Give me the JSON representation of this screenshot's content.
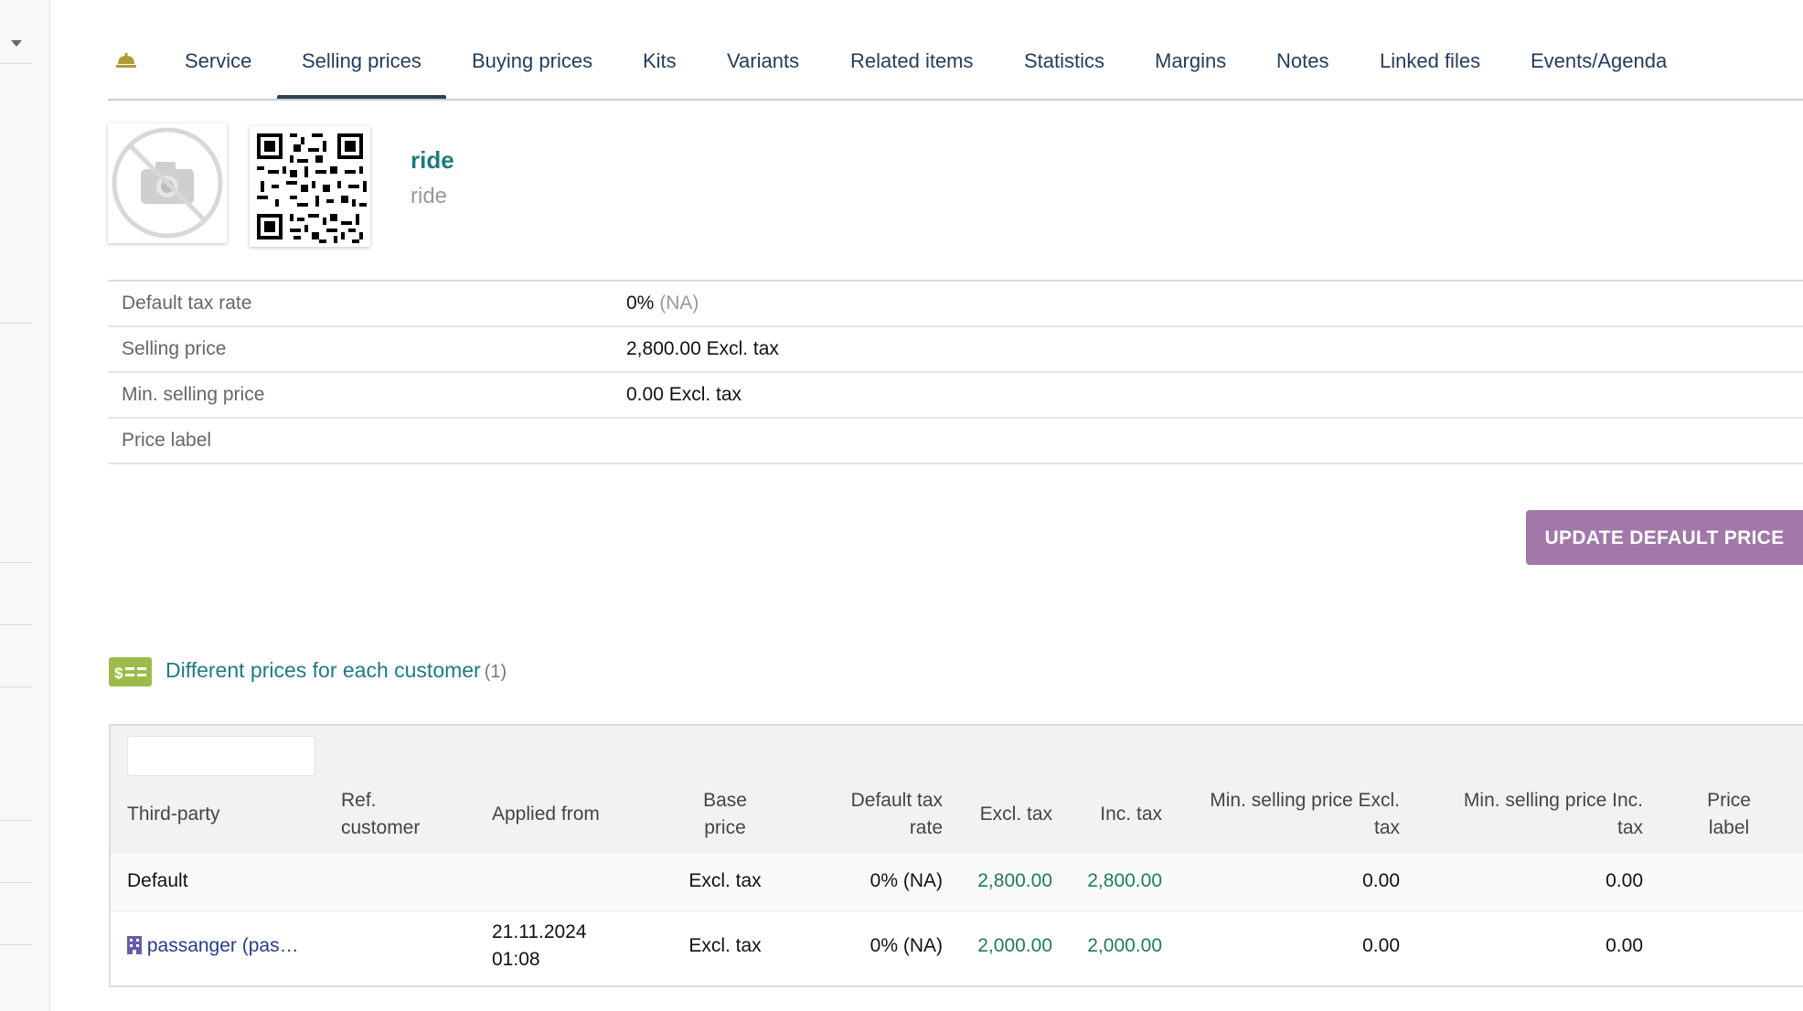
{
  "tabs": [
    {
      "label": "Service"
    },
    {
      "label": "Selling prices"
    },
    {
      "label": "Buying prices"
    },
    {
      "label": "Kits"
    },
    {
      "label": "Variants"
    },
    {
      "label": "Related items"
    },
    {
      "label": "Statistics"
    },
    {
      "label": "Margins"
    },
    {
      "label": "Notes"
    },
    {
      "label": "Linked files"
    },
    {
      "label": "Events/Agenda"
    }
  ],
  "active_tab": "Selling prices",
  "product": {
    "ref": "ride",
    "label": "ride"
  },
  "properties": [
    {
      "key": "Default tax rate",
      "value": "0%",
      "note": "(NA)"
    },
    {
      "key": "Selling price",
      "value": "2,800.00 Excl. tax",
      "note": ""
    },
    {
      "key": "Min. selling price",
      "value": "0.00 Excl. tax",
      "note": ""
    },
    {
      "key": "Price label",
      "value": "",
      "note": ""
    }
  ],
  "update_button": "UPDATE DEFAULT PRICE",
  "section": {
    "title": "Different prices for each customer",
    "count": "(1)"
  },
  "table": {
    "filter_placeholder": "",
    "headers": {
      "third_party": "Third-party",
      "ref_customer_1": "Ref.",
      "ref_customer_2": "customer",
      "applied_from": "Applied from",
      "base_price_1": "Base",
      "base_price_2": "price",
      "tax_rate_1": "Default tax",
      "tax_rate_2": "rate",
      "excl_tax": "Excl. tax",
      "inc_tax": "Inc. tax",
      "min_excl_1": "Min. selling price Excl.",
      "min_excl_2": "tax",
      "min_inc_1": "Min. selling price Inc.",
      "min_inc_2": "tax",
      "price_label_1": "Price",
      "price_label_2": "label"
    },
    "rows": [
      {
        "third_party": "Default",
        "ref_customer": "",
        "applied_from_date": "",
        "applied_from_time": "",
        "base_price": "Excl. tax",
        "tax_rate": "0% (NA)",
        "excl_tax": "2,800.00",
        "inc_tax": "2,800.00",
        "min_excl": "0.00",
        "min_inc": "0.00",
        "price_label": ""
      },
      {
        "third_party": "passanger (pas…",
        "ref_customer": "",
        "applied_from_date": "21.11.2024",
        "applied_from_time": "01:08",
        "base_price": "Excl. tax",
        "tax_rate": "0% (NA)",
        "excl_tax": "2,000.00",
        "inc_tax": "2,000.00",
        "min_excl": "0.00",
        "min_inc": "0.00",
        "price_label": ""
      }
    ]
  },
  "colors": {
    "accent_teal": "#1f7a80",
    "tab_text": "#263c5c",
    "button_purple": "#a178a9",
    "section_icon_green": "#9dbb4a"
  }
}
